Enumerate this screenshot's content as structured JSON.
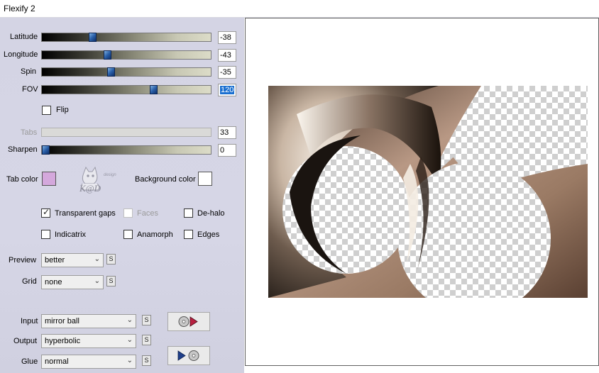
{
  "window": {
    "title": "Flexify 2"
  },
  "sliders": [
    {
      "label": "Latitude",
      "value": "-38",
      "position": 0.3
    },
    {
      "label": "Longitude",
      "value": "-43",
      "position": 0.39
    },
    {
      "label": "Spin",
      "value": "-35",
      "position": 0.41
    },
    {
      "label": "FOV",
      "value": "120",
      "position": 0.65
    }
  ],
  "flip": {
    "label": "Flip",
    "checked": false
  },
  "tabs": {
    "label": "Tabs",
    "value": "33",
    "enabled": false
  },
  "sharpen": {
    "label": "Sharpen",
    "value": "0",
    "position": 0.0
  },
  "colors": {
    "tab_color_label": "Tab color",
    "tab_color": "#d4a8dc",
    "background_color_label": "Background color",
    "background_color": "#ffffff"
  },
  "logo": {
    "text": "K@D",
    "icon": "cat-logo-icon"
  },
  "options": {
    "transparent_gaps": {
      "label": "Transparent gaps",
      "checked": true
    },
    "faces": {
      "label": "Faces",
      "checked": false,
      "enabled": false
    },
    "de_halo": {
      "label": "De-halo",
      "checked": false
    },
    "indicatrix": {
      "label": "Indicatrix",
      "checked": false
    },
    "anamorph": {
      "label": "Anamorph",
      "checked": false
    },
    "edges": {
      "label": "Edges",
      "checked": false
    }
  },
  "preview": {
    "label": "Preview",
    "value": "better",
    "s_label": "S"
  },
  "grid": {
    "label": "Grid",
    "value": "none",
    "s_label": "S"
  },
  "input": {
    "label": "Input",
    "value": "mirror ball",
    "s_label": "S"
  },
  "output": {
    "label": "Output",
    "value": "hyperbolic",
    "s_label": "S"
  },
  "glue": {
    "label": "Glue",
    "value": "normal",
    "s_label": "S"
  },
  "buttons": {
    "load_icon": "disc-play-right-icon",
    "save_icon": "play-disc-icon"
  },
  "accent": "#1a6fd0"
}
